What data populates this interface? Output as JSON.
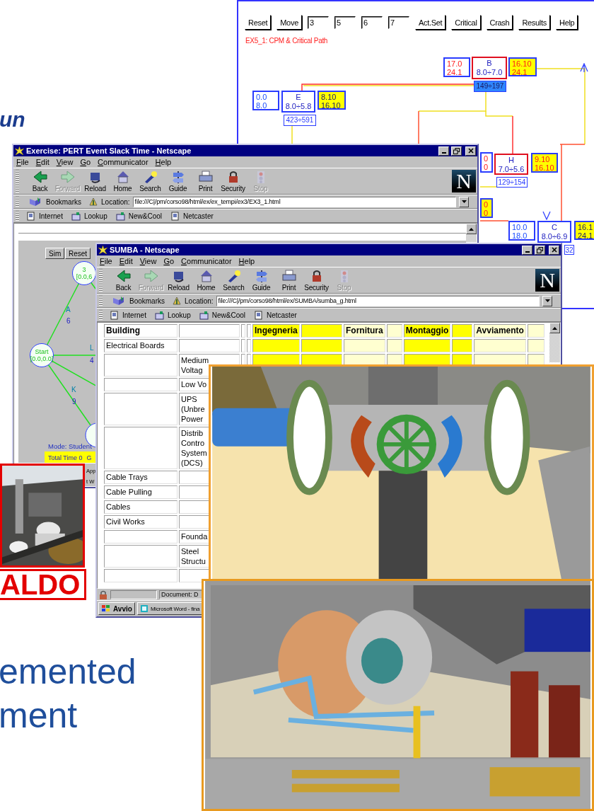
{
  "slide": {
    "heading_fragment": "un",
    "body_lines": [
      "emented",
      "ment"
    ],
    "logo_text": "ALDO"
  },
  "cpm_applet": {
    "buttons": [
      "Reset",
      "Move"
    ],
    "fields": [
      "3",
      "5",
      "6",
      "7"
    ],
    "buttons_after": [
      "Act.Set",
      "Critical",
      "Crash",
      "Results",
      "Help"
    ],
    "title": "EX5_1: CPM & Critical Path",
    "nodes": [
      {
        "name": "B",
        "duration": "8.0÷7.0",
        "critical": true,
        "early": [
          "17.0",
          "24.1"
        ],
        "late": [
          "16.10",
          "24.1"
        ],
        "range": "149÷197",
        "range_filled": true
      },
      {
        "name": "E",
        "duration": "8.0÷5.8",
        "critical": false,
        "early": [
          "0.0",
          "8.0"
        ],
        "late": [
          "8.10",
          "16.10"
        ],
        "range": "423÷591",
        "range_filled": false
      },
      {
        "name": "H",
        "duration": "7.0÷5.6",
        "critical": true,
        "early": [
          "0",
          "0"
        ],
        "late": [
          "9.10",
          "16.10"
        ],
        "range": "129÷154",
        "range_filled": false
      },
      {
        "name": "C",
        "duration": "8.0÷6.9",
        "critical": false,
        "early": [
          "10.0",
          "18.0"
        ],
        "late": [
          "16.1",
          "24.1"
        ],
        "range": "32",
        "range_filled": false
      }
    ],
    "partial_box": [
      "0",
      "0"
    ]
  },
  "pert_window": {
    "title": "Exercise: PERT Event Slack Time - Netscape",
    "menu": [
      "File",
      "Edit",
      "View",
      "Go",
      "Communicator",
      "Help"
    ],
    "toolbar": [
      {
        "label": "Back",
        "disabled": false
      },
      {
        "label": "Forward",
        "disabled": true
      },
      {
        "label": "Reload",
        "disabled": false
      },
      {
        "label": "Home",
        "disabled": false
      },
      {
        "label": "Search",
        "disabled": false
      },
      {
        "label": "Guide",
        "disabled": false
      },
      {
        "label": "Print",
        "disabled": false
      },
      {
        "label": "Security",
        "disabled": false
      },
      {
        "label": "Stop",
        "disabled": true
      }
    ],
    "logo": "N",
    "bookmarks": "Bookmarks",
    "location_label": "Location:",
    "location": "file:///C|/pm/corso98/html/ex/ex_tempi/ex3/EX3_1.html",
    "personal": [
      "Internet",
      "Lookup",
      "New&Cool",
      "Netcaster"
    ],
    "applet": {
      "buttons": [
        "Sim",
        "Reset"
      ],
      "nodes": [
        {
          "label": "3",
          "detail": "[0.0,6"
        },
        {
          "label": "Start",
          "detail": "[0.0,0.0]"
        }
      ],
      "edges": [
        {
          "name": "A",
          "duration": "6"
        },
        {
          "name": "L",
          "duration": "4"
        },
        {
          "name": "K",
          "duration": "9"
        }
      ],
      "mode": "Mode: Student",
      "total": "Total Time 0",
      "total_more": "G"
    },
    "taskbar_fragments": [
      "App",
      "t W"
    ]
  },
  "sumba_window": {
    "title": "SUMBA - Netscape",
    "menu": [
      "File",
      "Edit",
      "View",
      "Go",
      "Communicator",
      "Help"
    ],
    "toolbar": [
      {
        "label": "Back",
        "disabled": false
      },
      {
        "label": "Forward",
        "disabled": true
      },
      {
        "label": "Reload",
        "disabled": false
      },
      {
        "label": "Home",
        "disabled": false
      },
      {
        "label": "Search",
        "disabled": false
      },
      {
        "label": "Guide",
        "disabled": false
      },
      {
        "label": "Print",
        "disabled": false
      },
      {
        "label": "Security",
        "disabled": false
      },
      {
        "label": "Stop",
        "disabled": true
      }
    ],
    "logo": "N",
    "bookmarks": "Bookmarks",
    "location_label": "Location:",
    "location": "file:///C|/pm/corso98/html/ex/SUMBA/sumba_g.html",
    "personal": [
      "Internet",
      "Lookup",
      "New&Cool",
      "Netcaster"
    ],
    "table": {
      "columns": [
        {
          "header": "Building"
        },
        {},
        {},
        {},
        {
          "header": "Ingegneria",
          "color": "#ffff00"
        },
        {
          "color": "#ffff00"
        },
        {
          "header": "Fornitura",
          "color": "#ffffd0"
        },
        {
          "color": "#ffffd0"
        },
        {
          "header": "Montaggio",
          "color": "#ffff00"
        },
        {
          "color": "#ffff00"
        },
        {
          "header": "Avviamento",
          "color": "#ffffd0"
        },
        {
          "color": "#ffffd0"
        }
      ],
      "rows": [
        {
          "item": "Electrical Boards"
        },
        {
          "part": "Medium\nVoltag"
        },
        {
          "part": "Low Vo"
        },
        {
          "part": "UPS\n(Unbre\nPower"
        },
        {
          "part": "Distrib\nContro\nSystem\n(DCS)"
        },
        {
          "item": "Cable Trays"
        },
        {
          "item": "Cable Pulling"
        },
        {
          "item": "Cables"
        },
        {
          "item": "Civil Works"
        },
        {
          "part": "Founda"
        },
        {
          "part": "Steel\nStructu"
        },
        {}
      ]
    },
    "status": "Document: D",
    "taskbar": [
      "Avvio",
      "Microsoft Word - fina"
    ]
  }
}
